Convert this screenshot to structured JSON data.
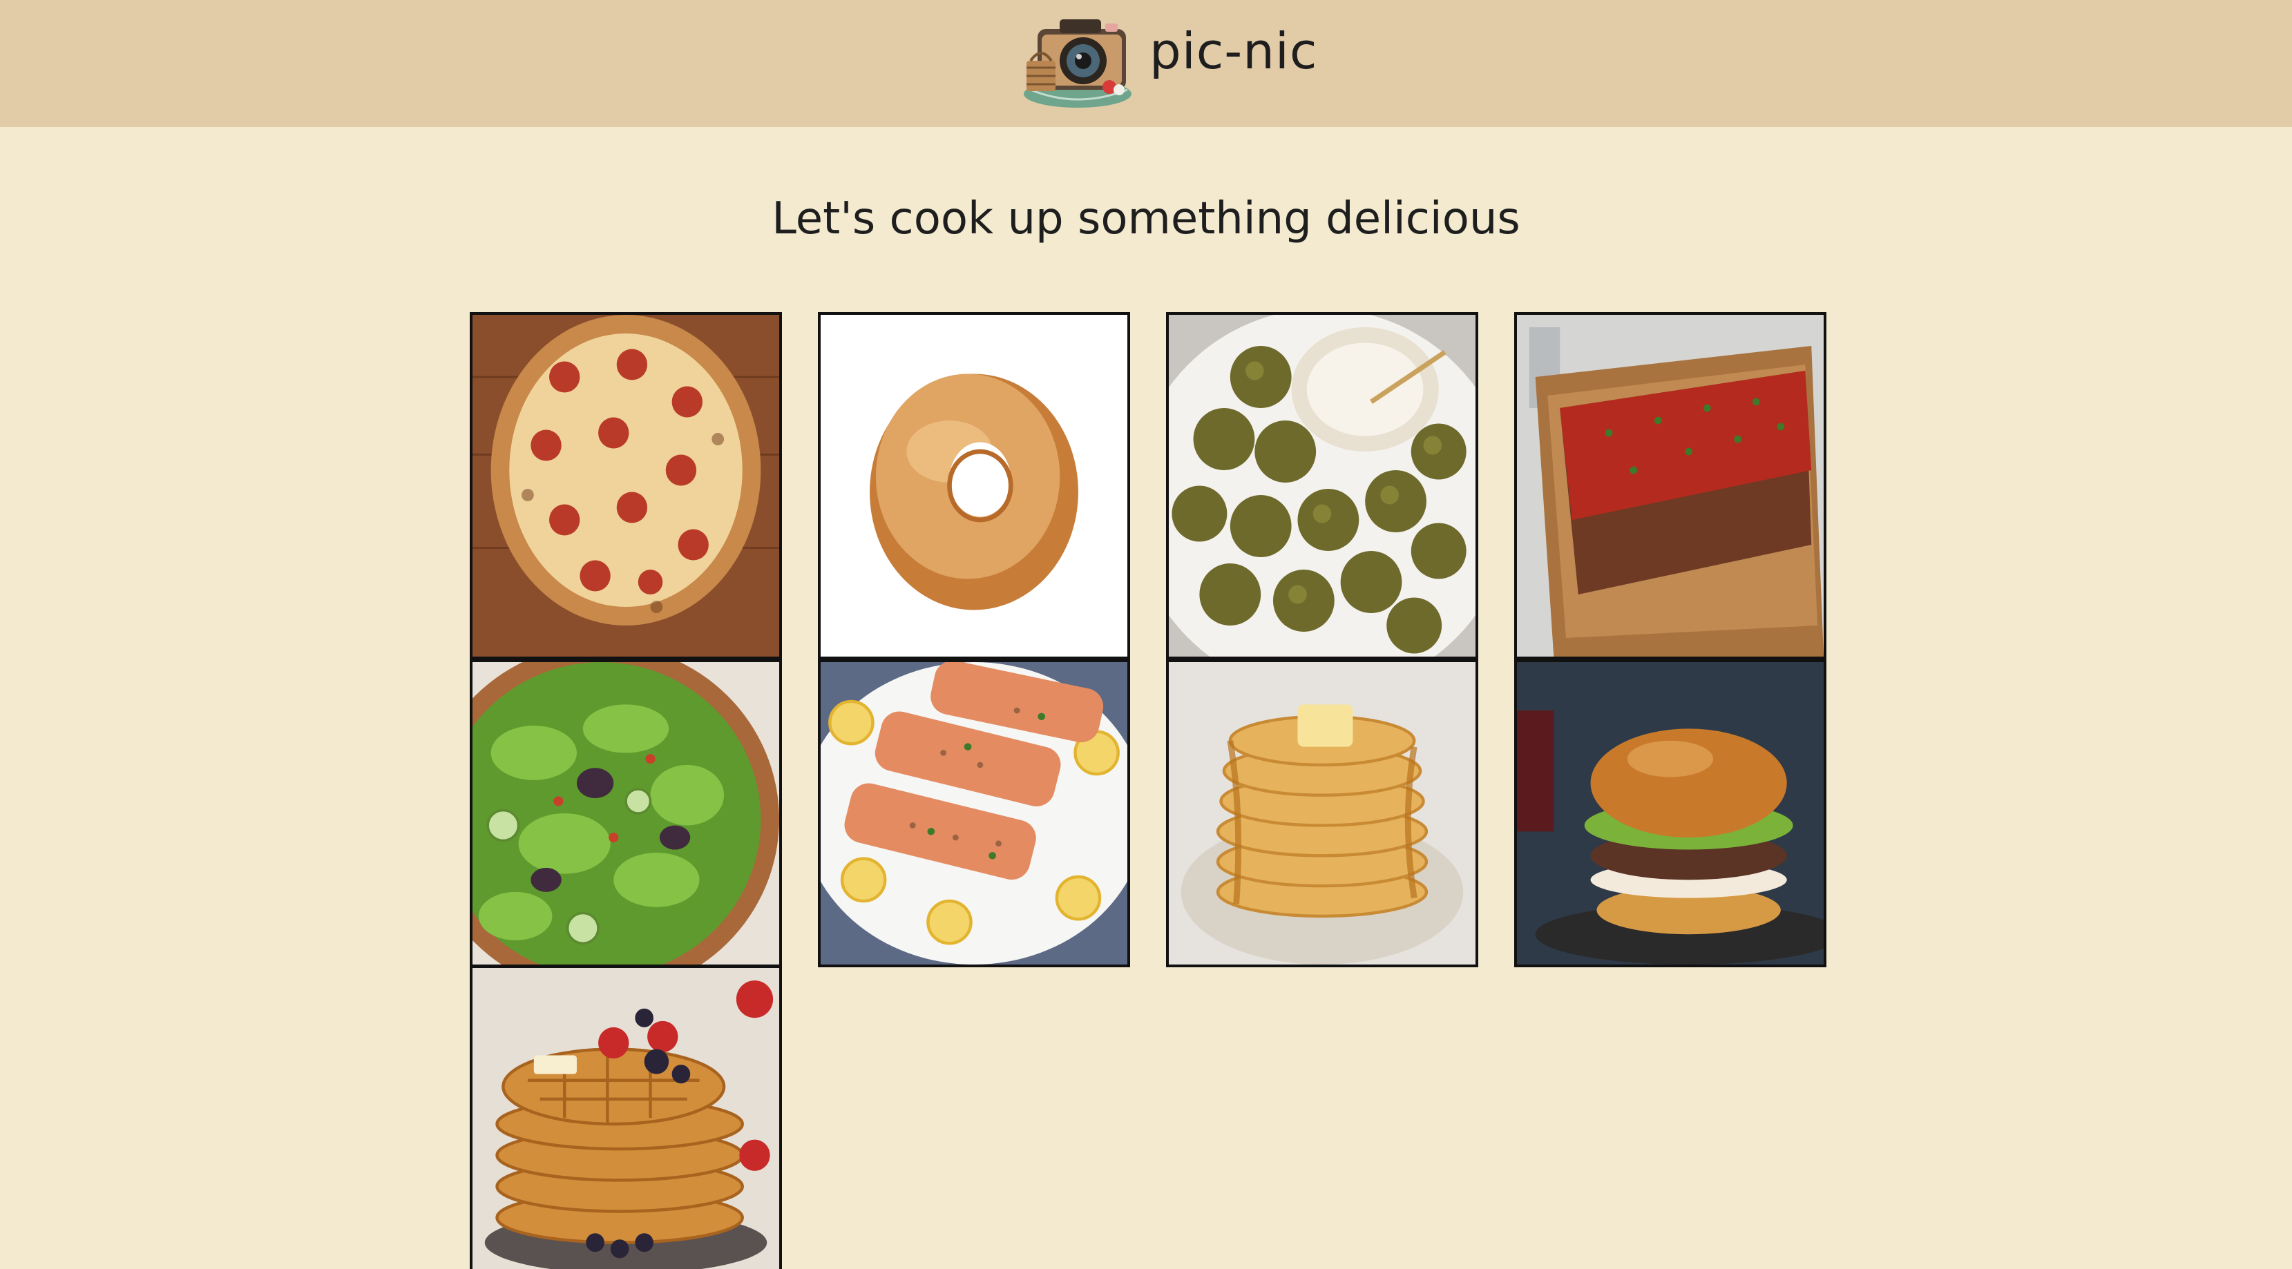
{
  "header": {
    "brand_name": "pic-nic",
    "logo_icon": "camera-picnic-basket-icon",
    "background": "#e2cca8"
  },
  "page": {
    "background": "#f3ead0",
    "heading": "Let's cook up something delicious"
  },
  "gallery": {
    "items": [
      {
        "name": "pepperoni pizza"
      },
      {
        "name": "glazed donut"
      },
      {
        "name": "falafel with sauce"
      },
      {
        "name": "meatloaf"
      },
      {
        "name": "green salad"
      },
      {
        "name": "baked salmon with lemon"
      },
      {
        "name": "pancakes with butter and syrup"
      },
      {
        "name": "burger"
      },
      {
        "name": "waffles with berries"
      }
    ]
  }
}
